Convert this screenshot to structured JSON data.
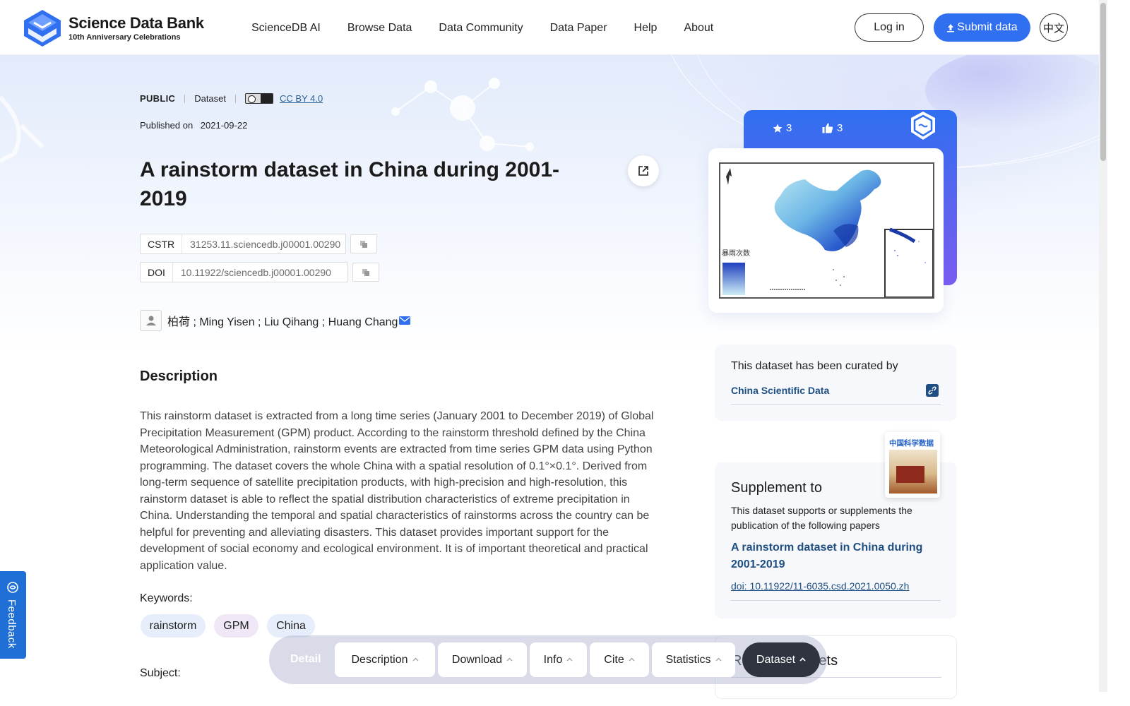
{
  "header": {
    "logo_title": "Science Data Bank",
    "logo_subtitle": "10th Anniversary Celebrations",
    "nav": [
      "ScienceDB AI",
      "Browse Data",
      "Data Community",
      "Data Paper",
      "Help",
      "About"
    ],
    "login_label": "Log in",
    "submit_label": "Submit data",
    "lang_label": "中文"
  },
  "meta": {
    "access": "PUBLIC",
    "type": "Dataset",
    "license": "CC BY 4.0",
    "published_label": "Published on",
    "published_date": "2021-09-22"
  },
  "dataset": {
    "title": "A rainstorm dataset in China during 2001-2019",
    "cstr_label": "CSTR",
    "cstr_value": "31253.11.sciencedb.j00001.00290",
    "doi_label": "DOI",
    "doi_value": "10.11922/sciencedb.j00001.00290",
    "authors": "柏荷 ; Ming Yisen ; Liu Qihang ; Huang Chang",
    "description_heading": "Description",
    "description": "This rainstorm dataset is extracted from a long time series (January 2001 to December 2019) of Global Precipitation Measurement (GPM) product. According to the rainstorm threshold defined by the China Meteorological Administration, rainstorm events are extracted from time series GPM data using Python programming. The dataset covers the whole China with a spatial resolution of 0.1°×0.1°. Derived from long-term sequence of satellite precipitation products, with high-precision and high-resolution, this rainstorm dataset is able to reflect the spatial distribution characteristics of extreme precipitation in China. Understanding the temporal and spatial characteristics of rainstorms across the country can be helpful for preventing and alleviating disasters. This dataset provides important support for the development of social economy and ecological environment. It is of important theoretical and practical application value.",
    "keywords_label": "Keywords:",
    "keywords": [
      "rainstorm",
      "GPM",
      "China"
    ],
    "subject_label": "Subject:"
  },
  "sidebar": {
    "stars": "3",
    "likes": "3",
    "map_legend_label": "暴雨次数",
    "curated_text": "This dataset has been curated by",
    "curated_org": "China Scientific Data",
    "journal_title": "中国科学数据",
    "supplement_title": "Supplement to",
    "supplement_desc": "This dataset supports or supplements the publication of the following papers",
    "paper_title": "A rainstorm dataset in China during 2001-2019",
    "paper_doi": "doi: 10.11922/11-6035.csd.2021.0050.zh",
    "related_title": "Related datasets"
  },
  "feedback_label": "Feedback",
  "bottom_nav": {
    "detail": "Detail",
    "items": [
      "Description",
      "Download",
      "Info",
      "Cite",
      "Statistics",
      "Dataset"
    ]
  },
  "colors": {
    "primary": "#2f6ff0",
    "link": "#1f4f82",
    "feedback": "#1f6fd6",
    "active_tab": "#2f3440"
  }
}
